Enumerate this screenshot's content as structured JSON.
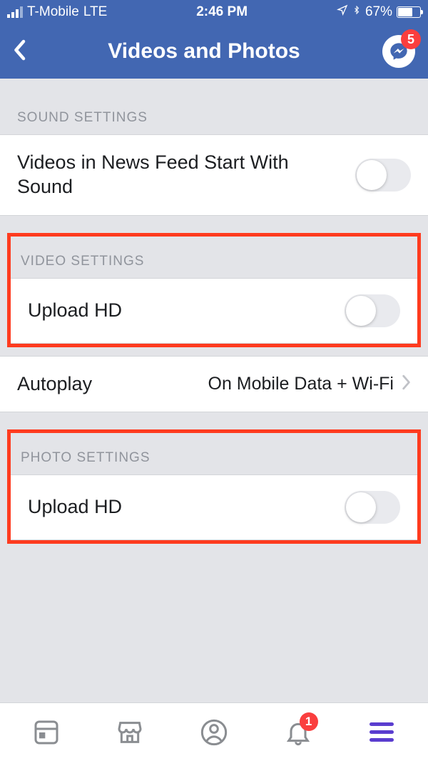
{
  "status": {
    "carrier": "T-Mobile",
    "network": "LTE",
    "time": "2:46 PM",
    "battery_pct": "67%"
  },
  "header": {
    "title": "Videos and Photos",
    "messenger_badge": "5"
  },
  "sections": {
    "sound": {
      "title": "SOUND SETTINGS",
      "row1_label": "Videos in News Feed Start With Sound"
    },
    "video": {
      "title": "VIDEO SETTINGS",
      "row1_label": "Upload HD",
      "row2_label": "Autoplay",
      "row2_value": "On Mobile Data + Wi-Fi"
    },
    "photo": {
      "title": "PHOTO SETTINGS",
      "row1_label": "Upload HD"
    }
  },
  "tabbar": {
    "notif_badge": "1"
  }
}
